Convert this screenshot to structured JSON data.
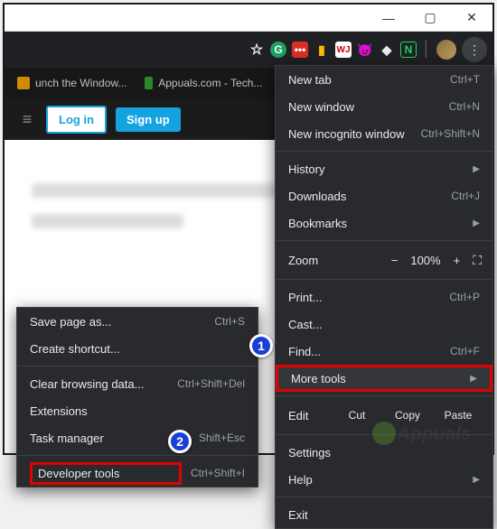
{
  "window_controls": {
    "minimize": "—",
    "maximize": "▢",
    "close": "✕"
  },
  "tabs": [
    {
      "title": "unch the Window..."
    },
    {
      "title": "Appuals.com - Tech..."
    }
  ],
  "page_header": {
    "login": "Log in",
    "signup": "Sign up"
  },
  "menu": {
    "new_tab": {
      "label": "New tab",
      "shortcut": "Ctrl+T"
    },
    "new_window": {
      "label": "New window",
      "shortcut": "Ctrl+N"
    },
    "new_incognito": {
      "label": "New incognito window",
      "shortcut": "Ctrl+Shift+N"
    },
    "history": {
      "label": "History"
    },
    "downloads": {
      "label": "Downloads",
      "shortcut": "Ctrl+J"
    },
    "bookmarks": {
      "label": "Bookmarks"
    },
    "zoom": {
      "label": "Zoom",
      "minus": "−",
      "value": "100%",
      "plus": "+",
      "fullscreen": "⛶"
    },
    "print": {
      "label": "Print...",
      "shortcut": "Ctrl+P"
    },
    "cast": {
      "label": "Cast..."
    },
    "find": {
      "label": "Find...",
      "shortcut": "Ctrl+F"
    },
    "more_tools": {
      "label": "More tools"
    },
    "edit": {
      "label": "Edit",
      "cut": "Cut",
      "copy": "Copy",
      "paste": "Paste"
    },
    "settings": {
      "label": "Settings"
    },
    "help": {
      "label": "Help"
    },
    "exit": {
      "label": "Exit"
    }
  },
  "submenu": {
    "save_page": {
      "label": "Save page as...",
      "shortcut": "Ctrl+S"
    },
    "create_shortcut": {
      "label": "Create shortcut..."
    },
    "clear_browsing": {
      "label": "Clear browsing data...",
      "shortcut": "Ctrl+Shift+Del"
    },
    "extensions": {
      "label": "Extensions"
    },
    "task_manager": {
      "label": "Task manager",
      "shortcut": "Shift+Esc"
    },
    "developer_tools": {
      "label": "Developer tools",
      "shortcut": "Ctrl+Shift+I"
    }
  },
  "callouts": {
    "one": "1",
    "two": "2"
  },
  "watermark": "Appuals"
}
